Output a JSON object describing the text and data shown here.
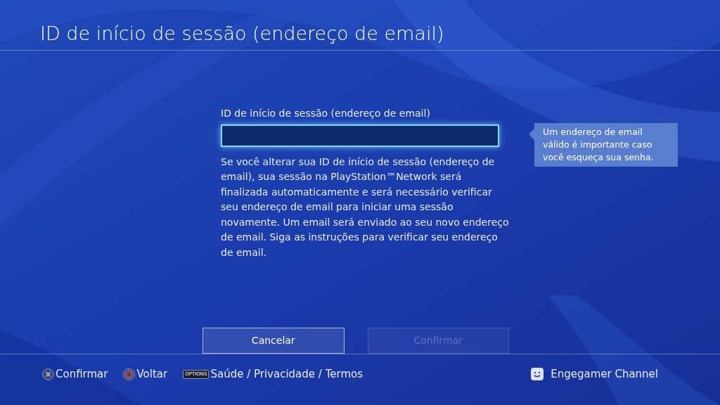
{
  "header": {
    "title": "ID de início de sessão (endereço de email)"
  },
  "form": {
    "field_label": "ID de início de sessão (endereço de email)",
    "field": {
      "focused": true
    },
    "description": "Se você alterar sua ID de início de sessão (endereço de email), sua sessão na PlayStation™Network será finalizada automaticamente e será necessário verificar seu endereço de email para iniciar uma sessão novamente. Um email será enviado ao seu novo endereço de email. Siga as instruções para verificar seu endereço de email.",
    "tooltip": "Um endereço de email válido é importante caso você esqueça sua senha."
  },
  "buttons": [
    {
      "label": "Cancelar",
      "disabled": false
    },
    {
      "label": "Confirmar",
      "disabled": true
    }
  ],
  "footer": {
    "hints": [
      {
        "kind": "cross",
        "label": "Confirmar"
      },
      {
        "kind": "circle",
        "label": "Voltar"
      },
      {
        "kind": "options",
        "key": "OPTIONS",
        "label": "Saúde / Privacidade / Termos"
      }
    ],
    "user": "Engegamer Channel"
  }
}
